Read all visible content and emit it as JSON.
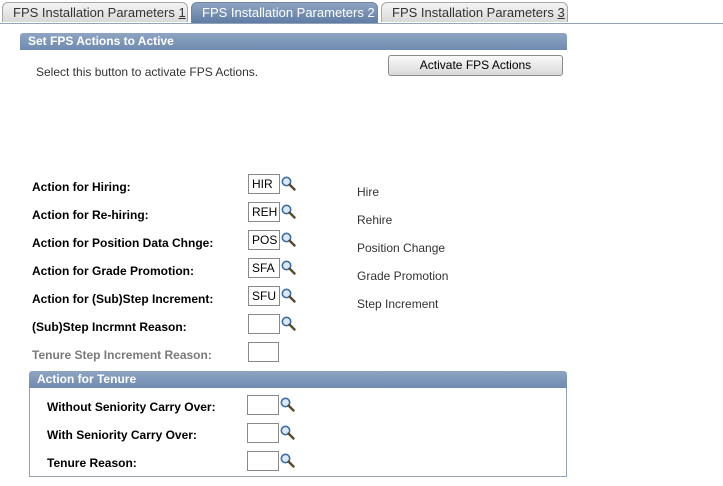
{
  "tabs": [
    {
      "label_prefix": "FPS Installation Parameters ",
      "accel": "1",
      "active": false
    },
    {
      "label_prefix": "FPS Installation Parameters 2",
      "accel": "",
      "active": true
    },
    {
      "label_prefix": "FPS Installation Parameters ",
      "accel": "3",
      "active": false
    }
  ],
  "activate_section": {
    "title": "Set FPS Actions to Active",
    "instruction": "Select this button to activate FPS Actions.",
    "button_label": "Activate FPS Actions"
  },
  "actions": [
    {
      "label": "Action for Hiring:",
      "value": "HIR",
      "description": "Hire"
    },
    {
      "label": "Action for Re-hiring:",
      "value": "REH",
      "description": "Rehire"
    },
    {
      "label": "Action for Position Data Chnge:",
      "value": "POS",
      "description": "Position Change"
    },
    {
      "label": "Action for Grade Promotion:",
      "value": "SFA",
      "description": "Grade Promotion"
    },
    {
      "label": "Action for (Sub)Step Increment:",
      "value": "SFU",
      "description": "Step Increment"
    },
    {
      "label": "(Sub)Step Incrmnt Reason:",
      "value": "",
      "description": ""
    },
    {
      "label": "Tenure Step Increment Reason:",
      "value": "",
      "description": ""
    }
  ],
  "tenure_section": {
    "title": "Action for Tenure",
    "items": [
      {
        "label": "Without Seniority Carry Over:",
        "value": ""
      },
      {
        "label": "With Seniority Carry Over:",
        "value": ""
      },
      {
        "label": "Tenure Reason:",
        "value": ""
      }
    ]
  },
  "icons": {
    "lookup": "magnifier-lookup-icon"
  },
  "colors": {
    "header": "#7b95b9",
    "border": "#93a4b8"
  }
}
